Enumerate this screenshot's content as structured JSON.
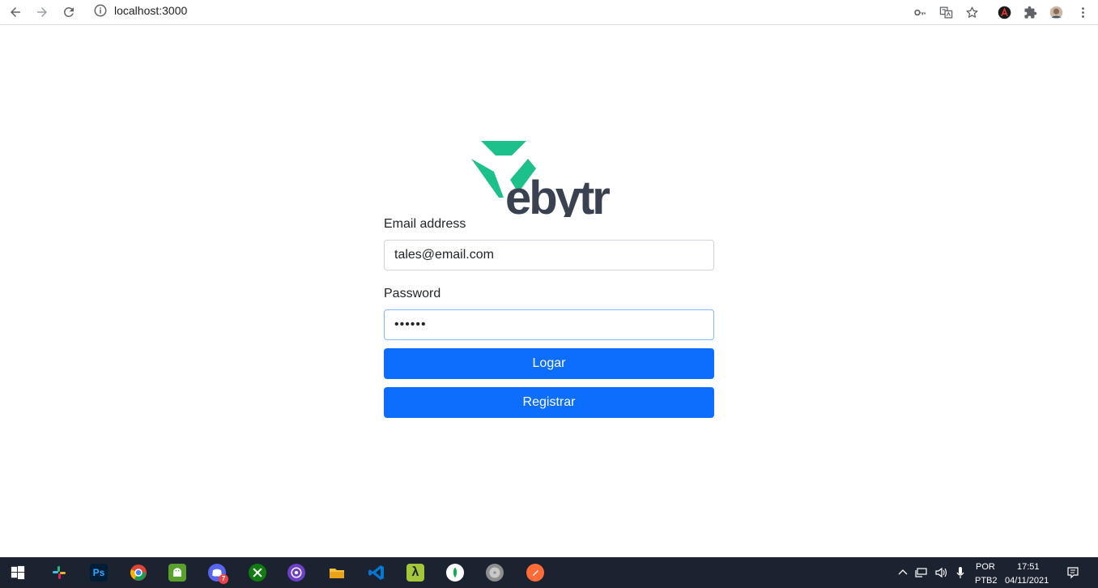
{
  "browser": {
    "url": "localhost:3000",
    "icons": [
      "back-arrow-icon",
      "forward-arrow-icon",
      "reload-icon",
      "info-icon",
      "key-icon",
      "translate-icon",
      "star-icon",
      "extension-a-icon",
      "puzzle-icon",
      "profile-avatar",
      "more-vert-icon"
    ]
  },
  "logo": {
    "text": "ebytr",
    "accent_color": "#1cc08a",
    "text_color": "#3a4150"
  },
  "form": {
    "email_label": "Email address",
    "email_value": "tales@email.com",
    "password_label": "Password",
    "password_value": "••••••",
    "login_button": "Logar",
    "register_button": "Registrar",
    "button_color": "#0d6efd"
  },
  "taskbar": {
    "apps": [
      "windows-start",
      "slack",
      "photoshop",
      "chrome",
      "android-studio",
      "discord",
      "xbox",
      "github-desktop",
      "file-explorer",
      "vscode",
      "lambda-app",
      "mongodb-compass",
      "disk-app",
      "postman"
    ],
    "photoshop_label": "Ps",
    "lambda_label": "λ",
    "discord_badge": "7",
    "tray": {
      "language_top": "POR",
      "language_bottom": "PTB2",
      "time": "17:51",
      "date": "04/11/2021"
    }
  }
}
